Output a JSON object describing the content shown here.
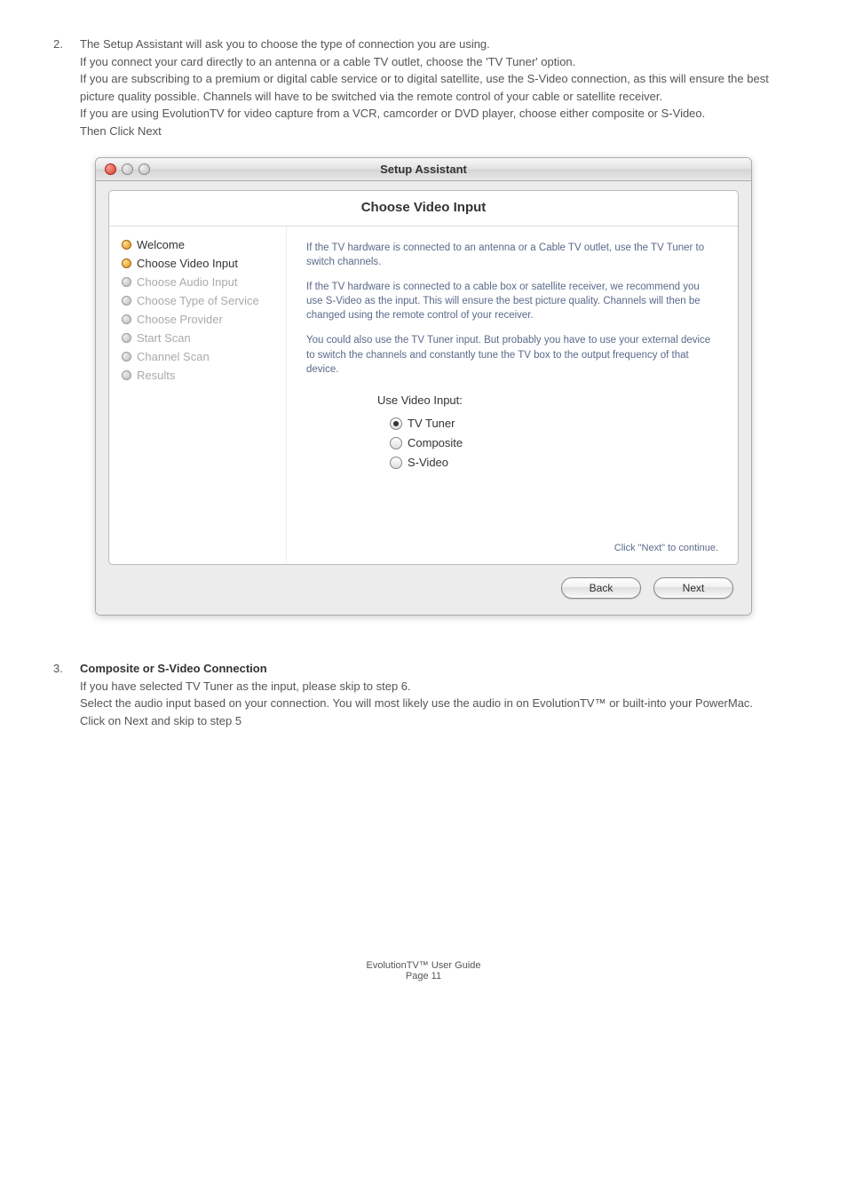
{
  "step2": {
    "num": "2.",
    "text": "The Setup Assistant will ask you to choose the type of connection you are using.\nIf you connect your card directly to an antenna or a cable TV outlet, choose the 'TV Tuner' option.\nIf you are subscribing to a premium or digital cable service or to digital satellite, use the S-Video connection, as this will ensure the best picture quality possible. Channels will have to be switched via the remote control of your cable or satellite receiver.\nIf you are using EvolutionTV  for video capture from a VCR, camcorder or DVD player, choose either composite or S-Video.\nThen Click Next"
  },
  "window": {
    "title": "Setup Assistant",
    "heading": "Choose Video Input",
    "sidebar": [
      {
        "label": "Welcome",
        "state": "completed"
      },
      {
        "label": "Choose Video Input",
        "state": "current"
      },
      {
        "label": "Choose Audio Input",
        "state": "pending"
      },
      {
        "label": "Choose Type of Service",
        "state": "pending"
      },
      {
        "label": "Choose Provider",
        "state": "pending"
      },
      {
        "label": "Start Scan",
        "state": "pending"
      },
      {
        "label": "Channel Scan",
        "state": "pending"
      },
      {
        "label": "Results",
        "state": "pending"
      }
    ],
    "para1": "If the TV hardware is connected to an antenna or a Cable TV outlet, use the TV Tuner to switch channels.",
    "para2": "If the TV hardware is connected to a cable box or satellite receiver, we recommend you use S-Video as the input. This will ensure the best picture quality. Channels will then be changed using the remote control of your receiver.",
    "para3": "You could also use the TV Tuner input. But probably you have to use your external device to switch the channels and constantly tune the TV box to the output frequency of that device.",
    "radio_label": "Use Video Input:",
    "radios": [
      {
        "label": "TV Tuner",
        "selected": true
      },
      {
        "label": "Composite",
        "selected": false
      },
      {
        "label": "S-Video",
        "selected": false
      }
    ],
    "hint": "Click \"Next\" to continue.",
    "back": "Back",
    "next": "Next"
  },
  "step3": {
    "num": "3.",
    "heading": "Composite or S-Video Connection",
    "text": "If you have selected TV Tuner as the input, please skip to step 6.\nSelect the audio input based on your connection. You will most likely use the audio in on EvolutionTV™ or built-into your PowerMac.\nClick on Next and skip to step 5"
  },
  "footer": {
    "line1": "EvolutionTV™ User Guide",
    "line2": "Page 11"
  }
}
